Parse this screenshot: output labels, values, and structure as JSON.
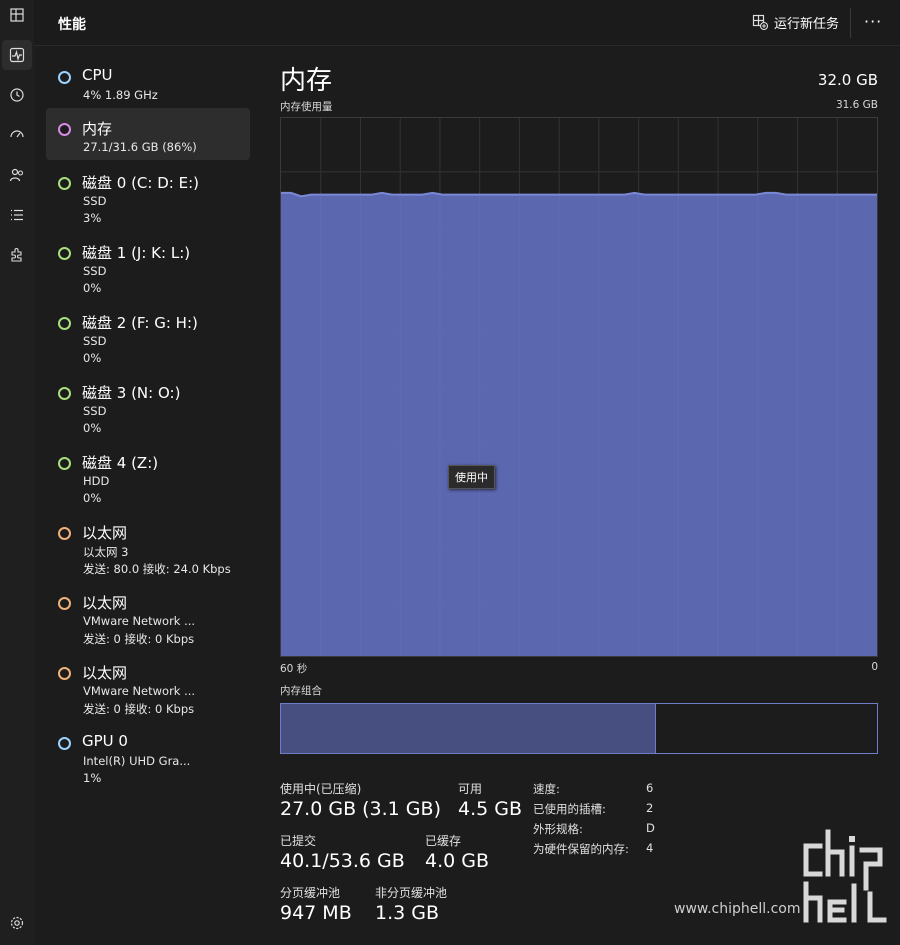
{
  "header": {
    "title": "性能",
    "run_task": "运行新任务",
    "more": "···"
  },
  "rail": {
    "icons": [
      "processes-icon",
      "performance-icon",
      "app-history-icon",
      "startup-icon",
      "users-icon",
      "details-icon",
      "services-icon",
      "settings-icon"
    ]
  },
  "sidebar": {
    "items": [
      {
        "name": "CPU",
        "l2": "4%  1.89 GHz",
        "l3": "",
        "color": "#9cd3ff"
      },
      {
        "name": "内存",
        "l2": "27.1/31.6 GB (86%)",
        "l3": "",
        "color": "#d68ce6"
      },
      {
        "name": "磁盘 0 (C: D: E:)",
        "l2": "SSD",
        "l3": "3%",
        "color": "#a8e07e"
      },
      {
        "name": "磁盘 1 (J: K: L:)",
        "l2": "SSD",
        "l3": "0%",
        "color": "#a8e07e"
      },
      {
        "name": "磁盘 2 (F: G: H:)",
        "l2": "SSD",
        "l3": "0%",
        "color": "#a8e07e"
      },
      {
        "name": "磁盘 3 (N: O:)",
        "l2": "SSD",
        "l3": "0%",
        "color": "#a8e07e"
      },
      {
        "name": "磁盘 4 (Z:)",
        "l2": "HDD",
        "l3": "0%",
        "color": "#a8e07e"
      },
      {
        "name": "以太网",
        "l2": "以太网 3",
        "l3": "发送: 80.0  接收: 24.0 Kbps",
        "color": "#f0b27a"
      },
      {
        "name": "以太网",
        "l2": "VMware Network ...",
        "l3": "发送: 0  接收: 0 Kbps",
        "color": "#f0b27a"
      },
      {
        "name": "以太网",
        "l2": "VMware Network ...",
        "l3": "发送: 0  接收: 0 Kbps",
        "color": "#f0b27a"
      },
      {
        "name": "GPU 0",
        "l2": "Intel(R) UHD Gra...",
        "l3": "1%",
        "color": "#9cd3ff"
      }
    ]
  },
  "memory": {
    "title": "内存",
    "total": "32.0 GB",
    "usage_label": "内存使用量",
    "max_label": "31.6 GB",
    "x_left": "60 秒",
    "x_right": "0",
    "tooltip": "使用中",
    "composition_label": "内存组合",
    "composition_in_use_fraction": 0.63,
    "colors": {
      "fill": "#5f6cb7",
      "line": "#7b88d6",
      "comp_fill": "#474e80"
    },
    "stats": {
      "in_use_label": "使用中(已压缩)",
      "in_use_value": "27.0 GB (3.1 GB)",
      "available_label": "可用",
      "available_value": "4.5 GB",
      "committed_label": "已提交",
      "committed_value": "40.1/53.6 GB",
      "cached_label": "已缓存",
      "cached_value": "4.0 GB",
      "paged_label": "分页缓冲池",
      "paged_value": "947 MB",
      "nonpaged_label": "非分页缓冲池",
      "nonpaged_value": "1.3 GB"
    },
    "details": [
      {
        "k": "速度:",
        "v": "6"
      },
      {
        "k": "已使用的插槽:",
        "v": "2"
      },
      {
        "k": "外形规格:",
        "v": "D"
      },
      {
        "k": "为硬件保留的内存:",
        "v": "4"
      }
    ]
  },
  "chart_data": {
    "type": "area",
    "title": "内存使用量",
    "xlabel": "",
    "ylabel": "",
    "x_range_label": [
      "60 秒",
      "0"
    ],
    "ylim": [
      0,
      31.6
    ],
    "series": [
      {
        "values": [
          27.2,
          27.2,
          27.0,
          27.1,
          27.1,
          27.1,
          27.1,
          27.1,
          27.1,
          27.1,
          27.2,
          27.1,
          27.1,
          27.1,
          27.1,
          27.2,
          27.1,
          27.1,
          27.1,
          27.1,
          27.1,
          27.1,
          27.1,
          27.1,
          27.1,
          27.1,
          27.1,
          27.1,
          27.1,
          27.1,
          27.1,
          27.1,
          27.1,
          27.1,
          27.1,
          27.2,
          27.1,
          27.1,
          27.1,
          27.1,
          27.1,
          27.1,
          27.1,
          27.1,
          27.1,
          27.1,
          27.1,
          27.1,
          27.2,
          27.2,
          27.1,
          27.1,
          27.1,
          27.1,
          27.1,
          27.1,
          27.1,
          27.1,
          27.1,
          27.1
        ]
      }
    ],
    "grid": true
  },
  "watermark": {
    "text": "www.chiphell.com",
    "logo": "chip hell"
  }
}
